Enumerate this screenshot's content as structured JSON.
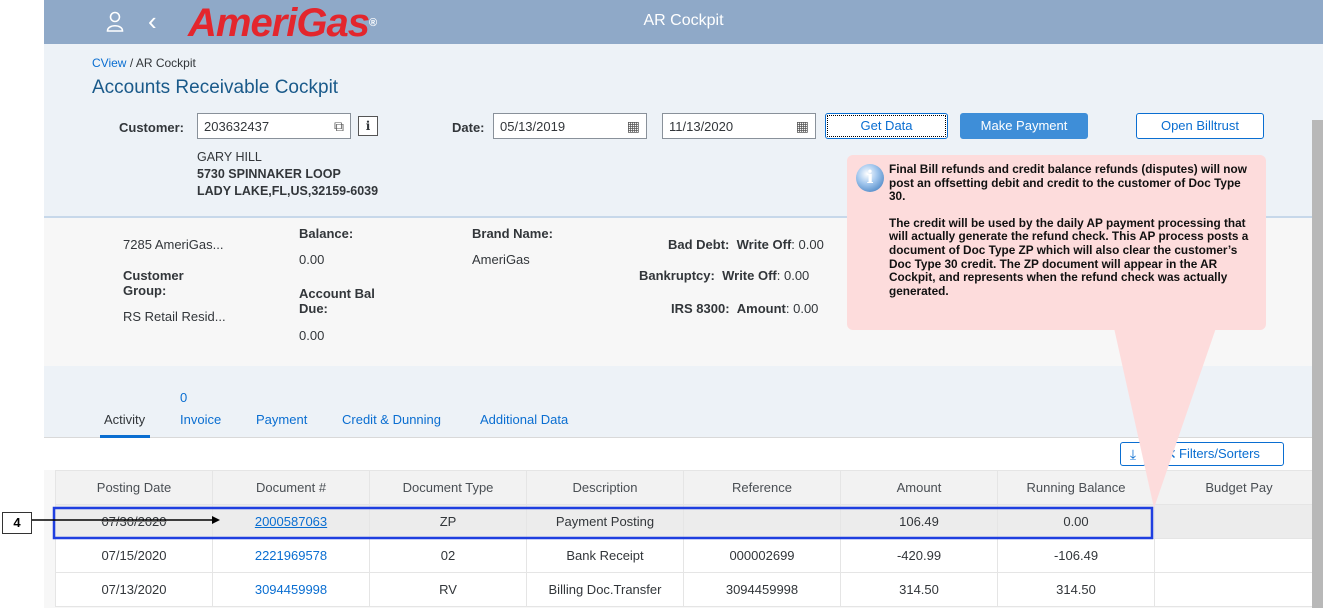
{
  "shell": {
    "title": "AR Cockpit",
    "brand": "AmeriGas",
    "brand_mark": "®"
  },
  "breadcrumb": {
    "link": "CView",
    "separator": "/",
    "current": "AR Cockpit"
  },
  "page_title": "Accounts Receivable Cockpit",
  "filters": {
    "customer_label": "Customer:",
    "customer_value": "203632437",
    "date_label": "Date:",
    "date_from": "05/13/2019",
    "date_to": "11/13/2020",
    "get_data": "Get Data",
    "make_payment": "Make Payment",
    "open_billtrust": "Open Billtrust"
  },
  "address": {
    "name": "GARY HILL",
    "street": "5730 SPINNAKER LOOP",
    "city": "LADY LAKE,FL,US,32159-6039"
  },
  "info": {
    "company": "7285 AmeriGas...",
    "customer_group_label": "Customer Group:",
    "customer_group_value": "RS Retail Resid...",
    "balance_label": "Balance:",
    "balance_value": "0.00",
    "account_bal_label": "Account Bal Due:",
    "account_bal_value": "0.00",
    "brand_label": "Brand Name:",
    "brand_value": "AmeriGas",
    "bad_debt_label": "Bad Debt:",
    "bad_debt_sub": "Write Off",
    "bad_debt_value": ": 0.00",
    "bankruptcy_label": "Bankruptcy:",
    "bankruptcy_sub": "Write Off",
    "bankruptcy_value": ": 0.00",
    "irs_label": "IRS 8300:",
    "irs_sub": "Amount",
    "irs_value": ": 0.00"
  },
  "tabs": [
    {
      "label": "Activity",
      "count": ""
    },
    {
      "label": "Invoice",
      "count": "0"
    },
    {
      "label": "Payment",
      "count": ""
    },
    {
      "label": "Credit & Dunning",
      "count": ""
    },
    {
      "label": "Additional Data",
      "count": ""
    }
  ],
  "toolbar": {
    "filters_label": "Filters/Sorters"
  },
  "table": {
    "columns": [
      "Posting Date",
      "Document #",
      "Document Type",
      "Description",
      "Reference",
      "Amount",
      "Running Balance",
      "Budget Pay"
    ],
    "rows": [
      [
        "07/30/2020",
        "2000587063",
        "ZP",
        "Payment Posting",
        "",
        "106.49",
        "0.00",
        ""
      ],
      [
        "07/15/2020",
        "2221969578",
        "02",
        "Bank Receipt",
        "000002699",
        "-420.99",
        "-106.49",
        ""
      ],
      [
        "07/13/2020",
        "3094459998",
        "RV",
        "Billing Doc.Transfer",
        "3094459998",
        "314.50",
        "314.50",
        ""
      ]
    ]
  },
  "callout": {
    "para1": "Final Bill refunds and credit balance refunds (disputes) will now post an offsetting debit and credit to the customer of Doc Type 30.",
    "para2": "The credit will be used by the daily AP payment processing that will actually generate the refund check. This AP process posts a document of Doc Type ZP which will also clear the customer’s Doc Type 30 credit. The ZP document will appear in the AR Cockpit, and represents when the refund check was actually generated."
  },
  "step_number": "4",
  "colors": {
    "shell": "#8fa9c8",
    "brand": "#e3262d",
    "accent": "#0a6ed1",
    "callout": "#fddcdc",
    "highlight": "#1f3fe0"
  }
}
